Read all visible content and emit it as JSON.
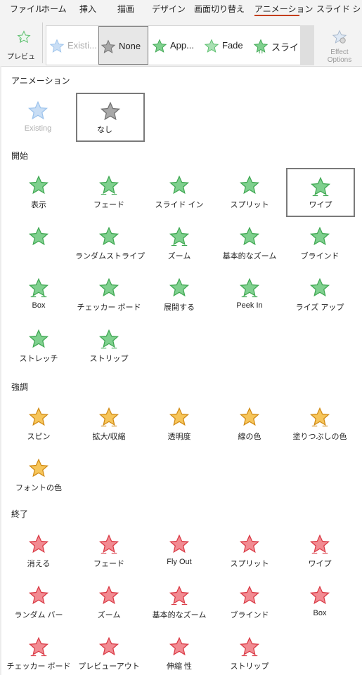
{
  "menu_tabs": [
    "ファイル",
    "ホーム",
    "挿入",
    "描画",
    "デザイン",
    "画面切り替え",
    "アニメーション",
    "スライド ショー"
  ],
  "ribbon": {
    "preview_label": "プレビュー",
    "gallery": [
      {
        "label": "Existi...",
        "kind": "existing",
        "state": "disabled"
      },
      {
        "label": "None",
        "kind": "none",
        "state": "selected"
      },
      {
        "label": "App...",
        "kind": "entrance",
        "state": "normal"
      },
      {
        "label": "Fade",
        "kind": "entrance",
        "state": "normal"
      },
      {
        "label": "スライド イン",
        "kind": "entrance",
        "state": "normal"
      }
    ],
    "effect_options_label": "Effect Options"
  },
  "panel": {
    "animation_header": "アニメーション",
    "animation_items": [
      {
        "label": "Existing",
        "kind": "existing",
        "disabled": true
      },
      {
        "label": "なし",
        "kind": "none",
        "selected": true
      }
    ],
    "entrance_header": "開始",
    "entrance_items": [
      "表示",
      "フェード",
      "スライド イン",
      "スプリット",
      "ワイプ",
      "",
      "ランダムストライプ",
      "ズーム",
      "基本的なズーム",
      "ブラインド",
      "Box",
      "チェッカー ボード",
      "展開する",
      "Peek In",
      "ライズ アップ",
      "ストレッチ",
      "ストリップ"
    ],
    "entrance_selected": "ワイプ",
    "emphasis_header": "強調",
    "emphasis_items": [
      "スピン",
      "拡大/収縮",
      "透明度",
      "線の色",
      "塗りつぶしの色",
      "フォントの色"
    ],
    "exit_header": "終了",
    "exit_items": [
      "消える",
      "フェード",
      "Fly Out",
      "スプリット",
      "ワイプ",
      "ランダム バー",
      "ズーム",
      "基本的なズーム",
      "ブラインド",
      "Box",
      "チェッカー ボード",
      "プレビューアウト",
      "伸縮 性",
      "ストリップ"
    ]
  },
  "colors": {
    "entrance_green": "#5cbf6e",
    "emphasis_gold": "#f2b43c",
    "exit_red": "#e8505b",
    "none_gray": "#8a8a8a",
    "existing_blue": "#9cc3ec",
    "accent_underline": "#c43e1c"
  }
}
